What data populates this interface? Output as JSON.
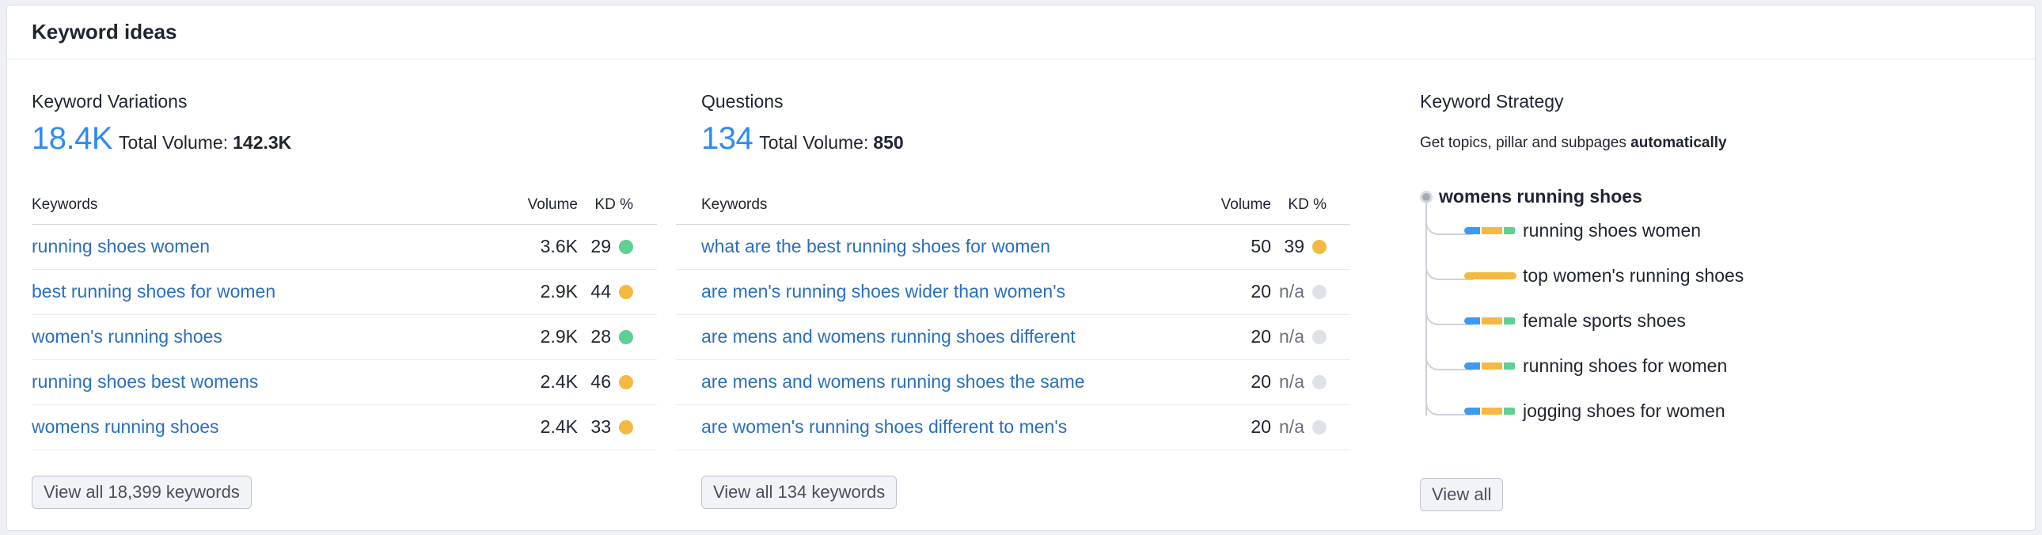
{
  "card": {
    "title": "Keyword ideas"
  },
  "variations": {
    "title": "Keyword Variations",
    "count": "18.4K",
    "total_volume_label": "Total Volume:",
    "total_volume": "142.3K",
    "columns": {
      "keyword": "Keywords",
      "volume": "Volume",
      "kd": "KD %"
    },
    "rows": [
      {
        "keyword": "running shoes women",
        "volume": "3.6K",
        "kd": "29",
        "kd_color": "#5fcf94"
      },
      {
        "keyword": "best running shoes for women",
        "volume": "2.9K",
        "kd": "44",
        "kd_color": "#f4b942"
      },
      {
        "keyword": "women's running shoes",
        "volume": "2.9K",
        "kd": "28",
        "kd_color": "#5fcf94"
      },
      {
        "keyword": "running shoes best womens",
        "volume": "2.4K",
        "kd": "46",
        "kd_color": "#f4b942"
      },
      {
        "keyword": "womens running shoes",
        "volume": "2.4K",
        "kd": "33",
        "kd_color": "#f4b942"
      }
    ],
    "view_all_label": "View all 18,399 keywords"
  },
  "questions": {
    "title": "Questions",
    "count": "134",
    "total_volume_label": "Total Volume:",
    "total_volume": "850",
    "columns": {
      "keyword": "Keywords",
      "volume": "Volume",
      "kd": "KD %"
    },
    "rows": [
      {
        "keyword": "what are the best running shoes for women",
        "volume": "50",
        "kd": "39",
        "kd_color": "#f4b942"
      },
      {
        "keyword": "are men's running shoes wider than women's",
        "volume": "20",
        "kd": "n/a",
        "kd_color": "#dfe1e8"
      },
      {
        "keyword": "are mens and womens running shoes different",
        "volume": "20",
        "kd": "n/a",
        "kd_color": "#dfe1e8"
      },
      {
        "keyword": "are mens and womens running shoes the same",
        "volume": "20",
        "kd": "n/a",
        "kd_color": "#dfe1e8"
      },
      {
        "keyword": "are women's running shoes different to men's",
        "volume": "20",
        "kd": "n/a",
        "kd_color": "#dfe1e8"
      }
    ],
    "view_all_label": "View all 134 keywords"
  },
  "strategy": {
    "title": "Keyword Strategy",
    "description": "Get topics, pillar and subpages",
    "description_bold": "automatically",
    "root": "womens running shoes",
    "children": [
      {
        "label": "running shoes women",
        "bar": [
          "#3d9af2",
          "#f4b942",
          "#5fcf94"
        ]
      },
      {
        "label": "top women's running shoes",
        "bar": [
          "#f4b942"
        ]
      },
      {
        "label": "female sports shoes",
        "bar": [
          "#3d9af2",
          "#f4b942",
          "#5fcf94"
        ]
      },
      {
        "label": "running shoes for women",
        "bar": [
          "#3d9af2",
          "#f4b942",
          "#5fcf94"
        ]
      },
      {
        "label": "jogging shoes for women",
        "bar": [
          "#3d9af2",
          "#f4b942",
          "#5fcf94"
        ]
      }
    ],
    "view_all_label": "View all"
  }
}
